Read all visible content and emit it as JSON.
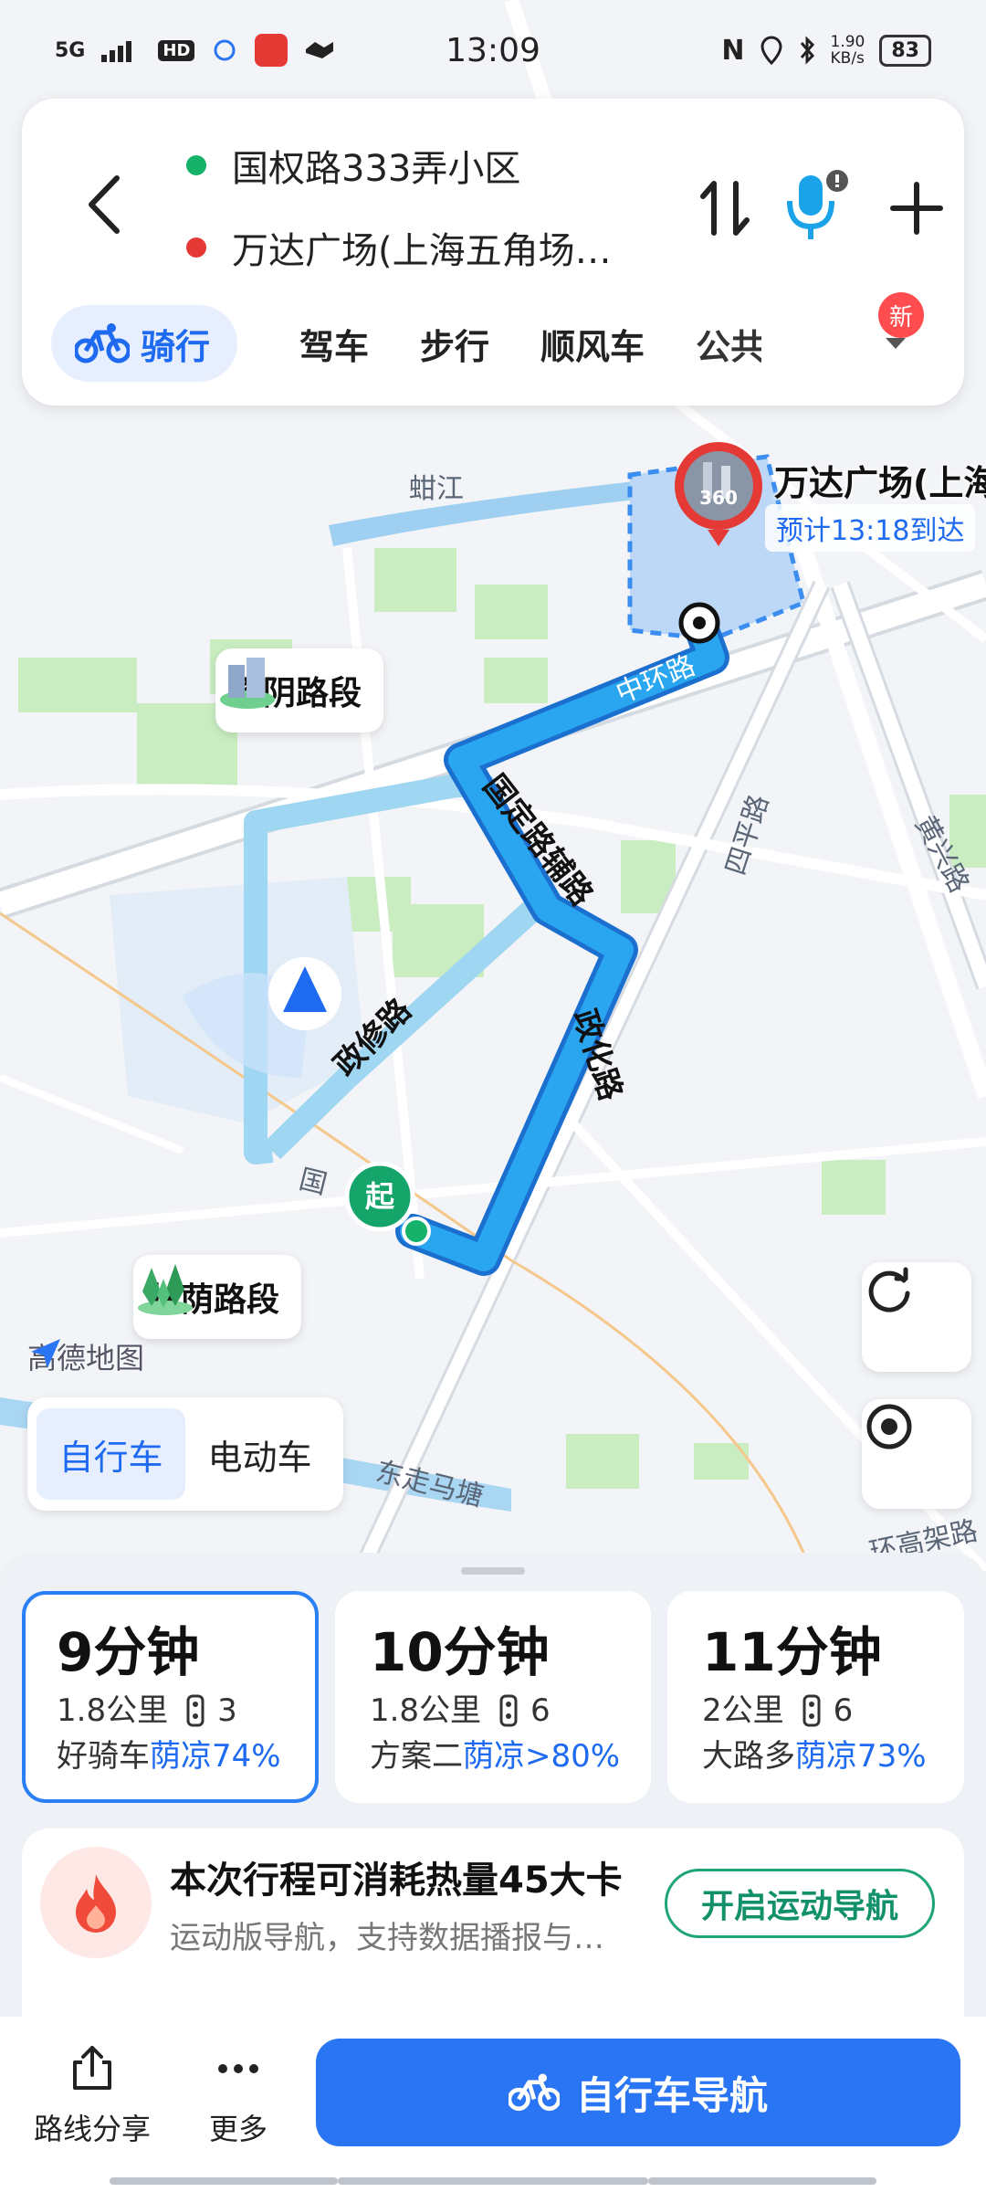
{
  "status_bar": {
    "network": "5G",
    "hd": "HD",
    "time": "13:09",
    "nfc": "N",
    "speed": "1.90",
    "speed_unit": "KB/s",
    "battery": "83"
  },
  "route_header": {
    "start": "国权路333弄小区",
    "end": "万达广场(上海五角场…",
    "start_color": "#17b26a",
    "end_color": "#e53935"
  },
  "modes": {
    "items": [
      "骑行",
      "驾车",
      "步行",
      "顺风车",
      "公共"
    ],
    "active_index": 0,
    "new_badge": "新"
  },
  "map": {
    "road_labels": [
      "蚶江",
      "中环路",
      "国定路辅路",
      "政化路",
      "政修路",
      "四平路",
      "黄兴路",
      "东走马塘",
      "环高架路",
      "国"
    ],
    "segment_labels": [
      "楼阴路段",
      "林荫路段"
    ],
    "start_marker": "起",
    "destination_name": "万达广场(上海",
    "destination_eta": "预计13:18到达",
    "dest_360": "360",
    "logo": "高德地图",
    "route_color": "#2aa6f0",
    "alt_route_color": "#9fd6f2"
  },
  "bike_type": {
    "options": [
      "自行车",
      "电动车"
    ],
    "active_index": 0
  },
  "routes": [
    {
      "time": "9分钟",
      "distance": "1.8公里",
      "lights": "3",
      "tag": "好骑车",
      "shade": "荫凉74%"
    },
    {
      "time": "10分钟",
      "distance": "1.8公里",
      "lights": "6",
      "tag": "方案二",
      "shade": "荫凉>80%"
    },
    {
      "time": "11分钟",
      "distance": "2公里",
      "lights": "6",
      "tag": "大路多",
      "shade": "荫凉73%"
    }
  ],
  "calorie": {
    "title": "本次行程可消耗热量45大卡",
    "subtitle": "运动版导航，支持数据播报与…",
    "button": "开启运动导航"
  },
  "bottom_bar": {
    "share": "路线分享",
    "more": "更多",
    "navigate": "自行车导航"
  },
  "colors": {
    "accent": "#2a75f3",
    "green": "#1fa37a",
    "shade_blue": "#1e6af0"
  }
}
